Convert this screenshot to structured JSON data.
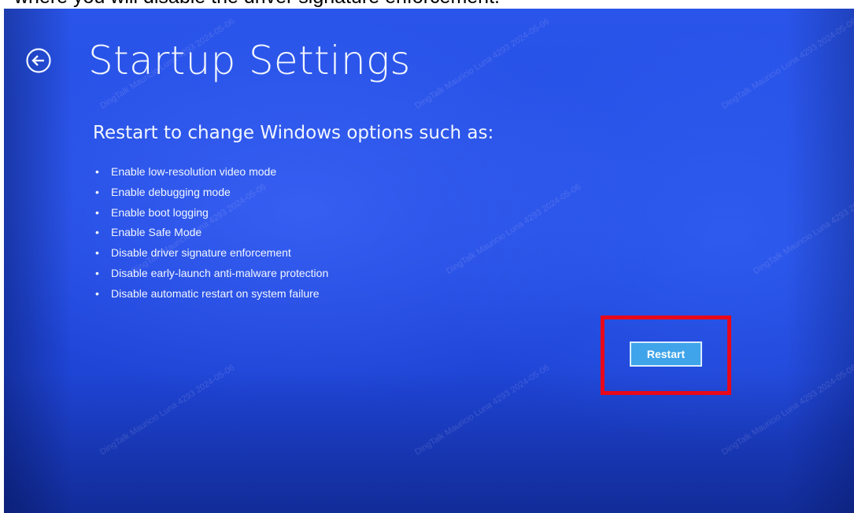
{
  "caption": {
    "text": "where you will disable the driver signature enforcement."
  },
  "screen": {
    "back_icon": "back-arrow-circle-icon",
    "title": "Startup Settings",
    "subtitle": "Restart to change Windows options such as:",
    "options": [
      "Enable low-resolution video mode",
      "Enable debugging mode",
      "Enable boot logging",
      "Enable Safe Mode",
      "Disable driver signature enforcement",
      "Disable early-launch anti-malware protection",
      "Disable automatic restart on system failure"
    ],
    "bullet": "•",
    "restart_label": "Restart"
  },
  "watermark": {
    "text": "DingTalk Mauricio Luna 4293 2024-05-06"
  },
  "colors": {
    "background": "#2149de",
    "text": "#f2f6ff",
    "button": "#3fa4ea",
    "highlight": "#e8081a"
  }
}
